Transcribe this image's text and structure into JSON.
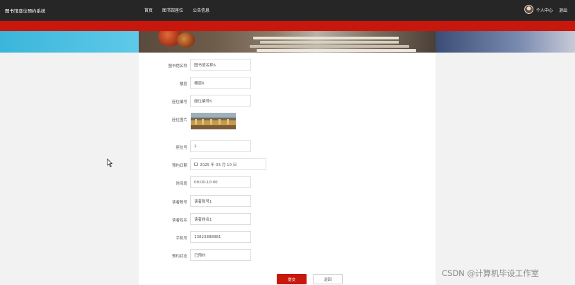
{
  "header": {
    "brand": "图书馆座位预约系统",
    "nav": [
      "首页",
      "图书馆座位",
      "公告信息"
    ],
    "user_center": "个人中心",
    "logout": "退出"
  },
  "form": {
    "rows": [
      {
        "label": "图书馆名称",
        "value": "图书馆名称6"
      },
      {
        "label": "楼层",
        "value": "楼层6"
      },
      {
        "label": "座位编号",
        "value": "座位编号6"
      },
      {
        "label": "座位图片"
      },
      {
        "label": "座位号",
        "value": "2"
      },
      {
        "label": "预约日期",
        "value": "2025 年 03 月 10 日"
      },
      {
        "label": "时间段",
        "value": "09:00-10:00"
      },
      {
        "label": "读者账号",
        "value": "读者账号1"
      },
      {
        "label": "读者姓名",
        "value": "读者姓名1"
      },
      {
        "label": "手机号",
        "value": "13823888881"
      },
      {
        "label": "预约状态",
        "value": "已预约"
      }
    ],
    "submit_label": "提交",
    "back_label": "返回"
  },
  "watermark": "CSDN @计算机毕设工作室"
}
